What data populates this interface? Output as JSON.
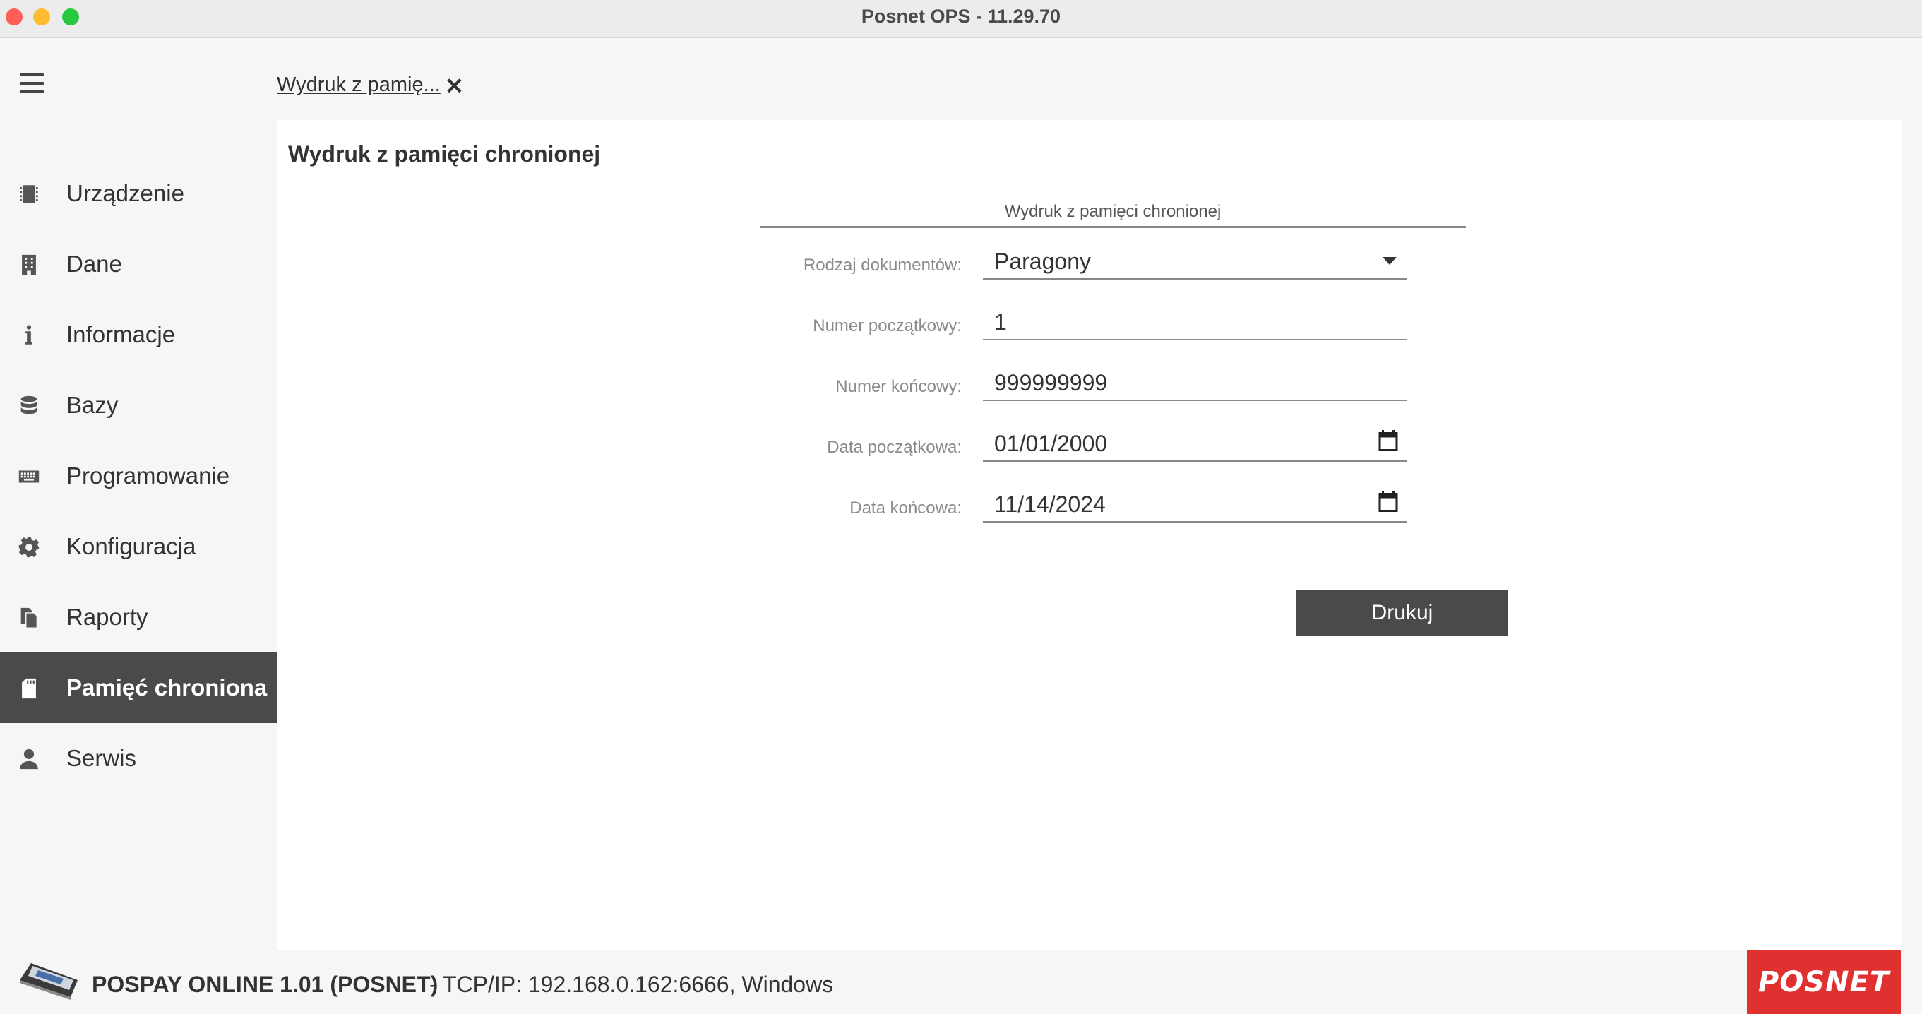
{
  "window": {
    "title": "Posnet OPS - 11.29.70"
  },
  "sidebar": {
    "items": [
      {
        "label": "Urządzenie",
        "icon": "chip-icon"
      },
      {
        "label": "Dane",
        "icon": "building-icon"
      },
      {
        "label": "Informacje",
        "icon": "info-icon"
      },
      {
        "label": "Bazy",
        "icon": "database-icon"
      },
      {
        "label": "Programowanie",
        "icon": "keyboard-icon"
      },
      {
        "label": "Konfiguracja",
        "icon": "gear-icon"
      },
      {
        "label": "Raporty",
        "icon": "documents-icon"
      },
      {
        "label": "Pamięć chroniona",
        "icon": "sd-card-icon",
        "active": true
      },
      {
        "label": "Serwis",
        "icon": "person-icon"
      }
    ]
  },
  "tab": {
    "label": "Wydruk z pamię...",
    "close": "✕"
  },
  "panel": {
    "title": "Wydruk z pamięci chronionej",
    "section_title": "Wydruk z pamięci chronionej",
    "fields": {
      "doc_type": {
        "label": "Rodzaj dokumentów:",
        "value": "Paragony"
      },
      "start_number": {
        "label": "Numer początkowy:",
        "value": "1"
      },
      "end_number": {
        "label": "Numer końcowy:",
        "value": "999999999"
      },
      "start_date": {
        "label": "Data początkowa:",
        "value": "01/01/2000"
      },
      "end_date": {
        "label": "Data końcowa:",
        "value": "11/14/2024"
      }
    },
    "print_button": "Drukuj"
  },
  "status": {
    "device": "POSPAY ONLINE 1.01 (POSNET)",
    "connection": "- TCP/IP:  192.168.0.162:6666, Windows"
  },
  "logo": {
    "text": "POSNET"
  },
  "colors": {
    "accent": "#4a4a4a",
    "brand": "#e03030"
  }
}
